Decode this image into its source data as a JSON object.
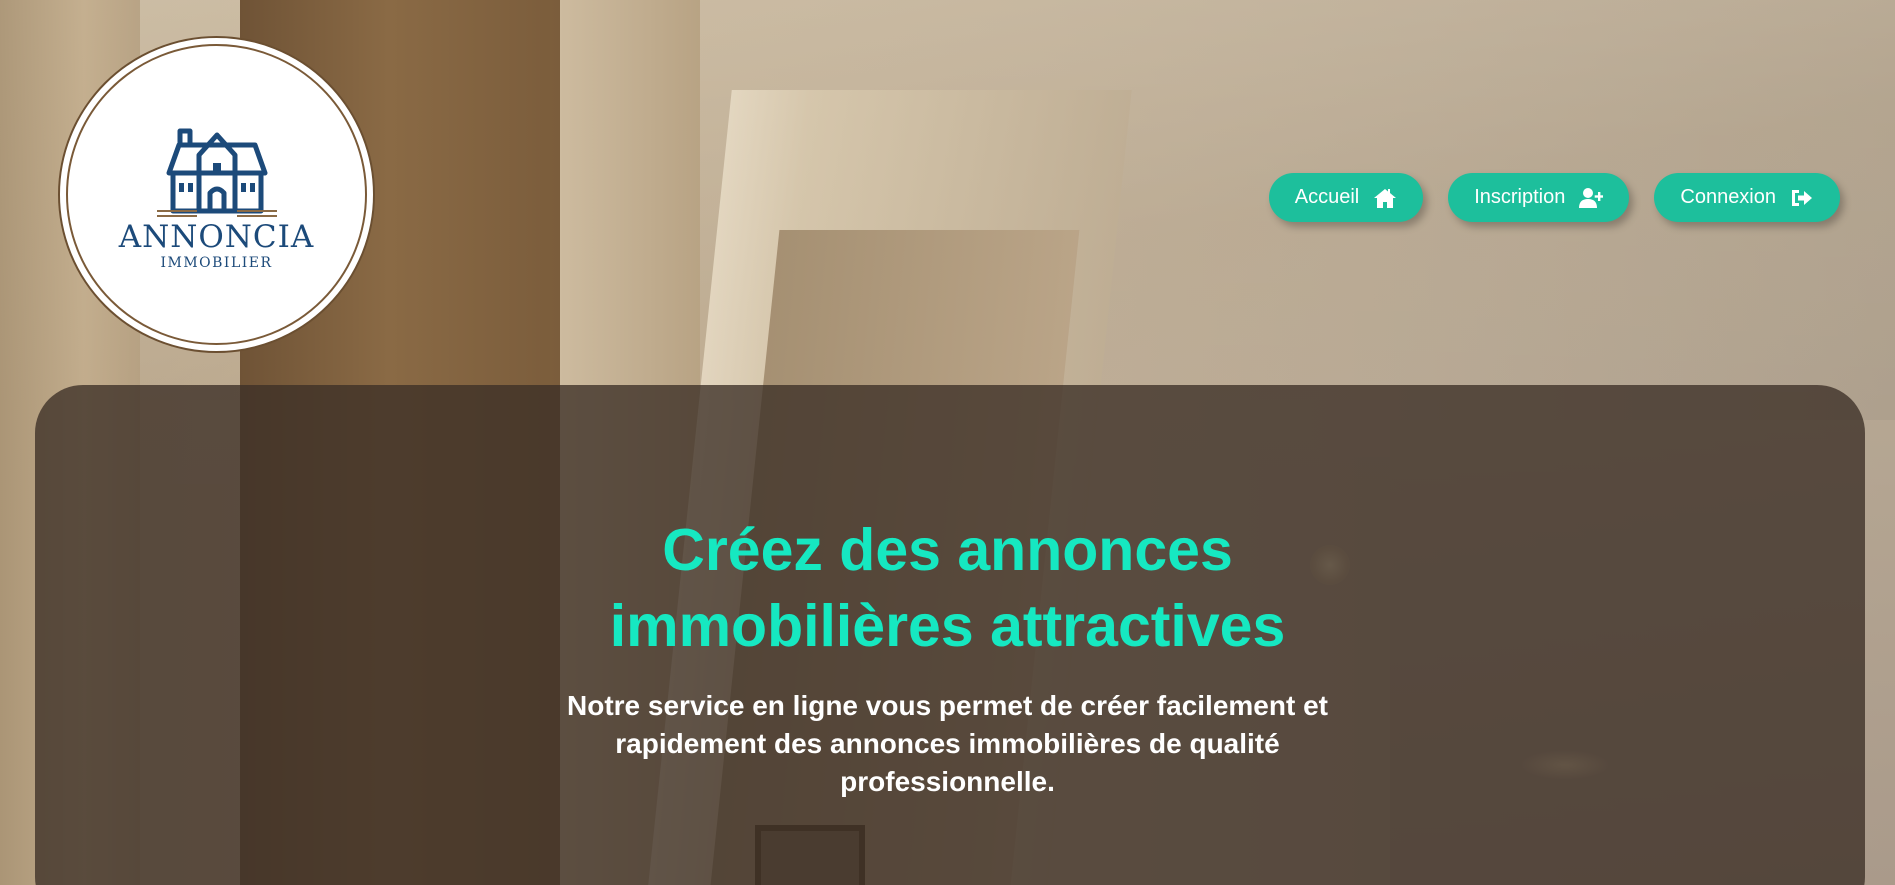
{
  "logo": {
    "brand": "ANNONCIA",
    "subtitle": "IMMOBILIER",
    "icon": "house-icon"
  },
  "nav": {
    "items": [
      {
        "label": "Accueil",
        "icon": "home-icon"
      },
      {
        "label": "Inscription",
        "icon": "user-plus-icon"
      },
      {
        "label": "Connexion",
        "icon": "sign-in-icon"
      }
    ]
  },
  "hero": {
    "title_lines": [
      "Créez des annonces",
      "immobilières attractives"
    ],
    "text_lines": [
      "Notre service en ligne vous permet de créer facilement et",
      "rapidement des annonces immobilières de qualité",
      "professionnelle."
    ]
  },
  "colors": {
    "accent": "#1dbf9c",
    "title": "#16e8c1",
    "logo_text": "#1c4a7a",
    "panel": "#3c3026"
  }
}
